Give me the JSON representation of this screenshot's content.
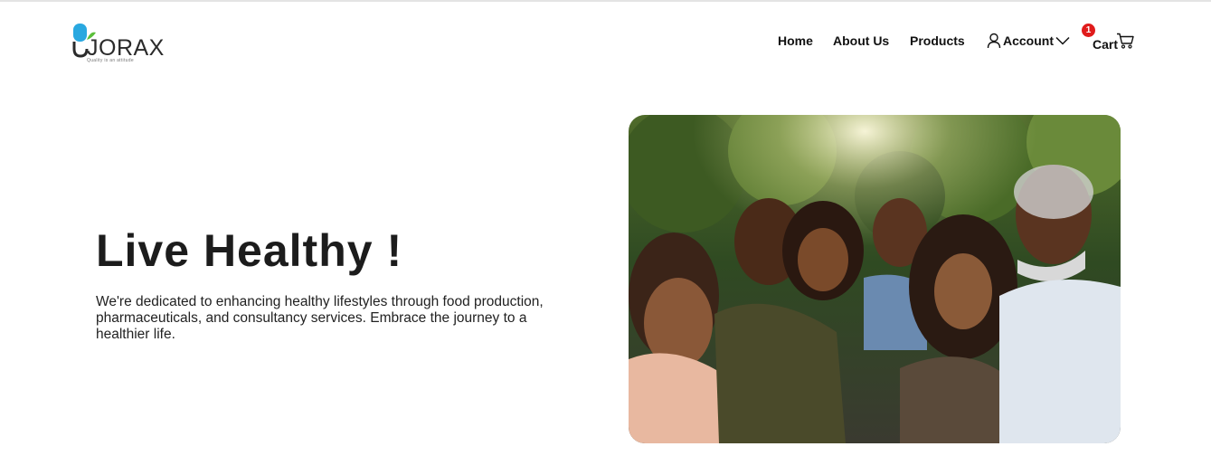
{
  "brand": {
    "name": "JORAX",
    "tagline": "Quality is an attitude",
    "colors": {
      "pill_blue": "#29a8e0",
      "leaf_green": "#5bbf3a",
      "text_dark": "#2b2b2b"
    }
  },
  "nav": {
    "home": "Home",
    "about": "About Us",
    "products": "Products",
    "account": "Account",
    "cart": "Cart",
    "cart_count": "1"
  },
  "hero": {
    "title": "Live Healthy !",
    "description": "We're dedicated to enhancing healthy lifestyles through food production, pharmaceuticals, and consultancy services. Embrace the journey to a healthier life.",
    "image_alt": "Smiling multi-generational family outdoors"
  },
  "colors": {
    "badge_red": "#e01b1b",
    "heading": "#1c1c1c"
  }
}
